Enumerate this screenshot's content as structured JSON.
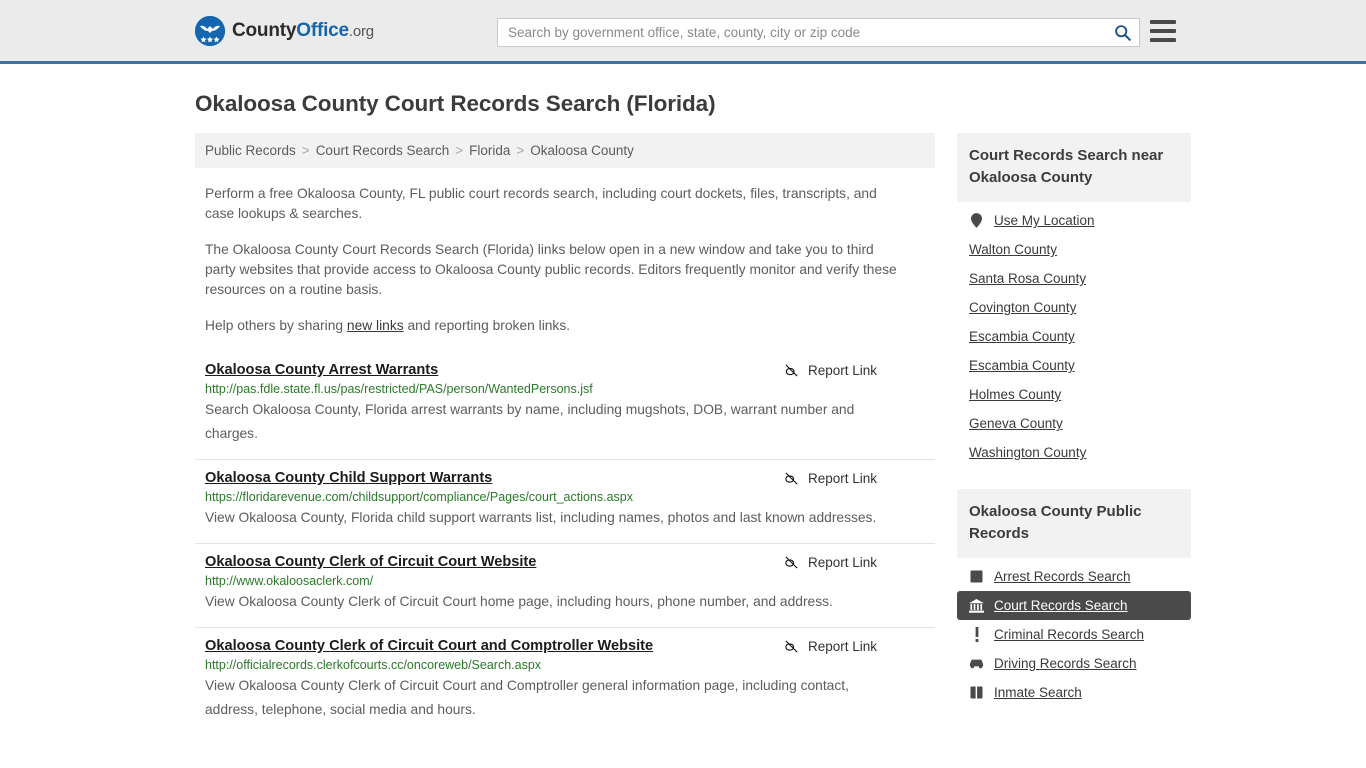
{
  "header": {
    "brand": {
      "part1": "County",
      "part2": "Office",
      "part3": ".org"
    },
    "search": {
      "placeholder": "Search by government office, state, county, city or zip code",
      "value": "",
      "icon": "search-icon"
    },
    "menu_icon": "hamburger-menu-icon"
  },
  "page": {
    "title": "Okaloosa County Court Records Search (Florida)"
  },
  "breadcrumb": {
    "items": [
      {
        "label": "Public Records"
      },
      {
        "label": "Court Records Search"
      },
      {
        "label": "Florida"
      },
      {
        "label": "Okaloosa County"
      }
    ],
    "separator": ">"
  },
  "intro": {
    "p1": "Perform a free Okaloosa County, FL public court records search, including court dockets, files, transcripts, and case lookups & searches.",
    "p2": "The Okaloosa County Court Records Search (Florida) links below open in a new window and take you to third party websites that provide access to Okaloosa County public records. Editors frequently monitor and verify these resources on a routine basis.",
    "p3_before": "Help others by sharing ",
    "p3_link": "new links",
    "p3_after": " and reporting broken links."
  },
  "report_link_label": "Report Link",
  "results": [
    {
      "title": "Okaloosa County Arrest Warrants",
      "url": "http://pas.fdle.state.fl.us/pas/restricted/PAS/person/WantedPersons.jsf",
      "description": "Search Okaloosa County, Florida arrest warrants by name, including mugshots, DOB, warrant number and charges."
    },
    {
      "title": "Okaloosa County Child Support Warrants",
      "url": "https://floridarevenue.com/childsupport/compliance/Pages/court_actions.aspx",
      "description": "View Okaloosa County, Florida child support warrants list, including names, photos and last known addresses."
    },
    {
      "title": "Okaloosa County Clerk of Circuit Court Website",
      "url": "http://www.okaloosaclerk.com/",
      "description": "View Okaloosa County Clerk of Circuit Court home page, including hours, phone number, and address."
    },
    {
      "title": "Okaloosa County Clerk of Circuit Court and Comptroller Website",
      "url": "http://officialrecords.clerkofcourts.cc/oncoreweb/Search.aspx",
      "description": "View Okaloosa County Clerk of Circuit Court and Comptroller general information page, including contact, address, telephone, social media and hours."
    }
  ],
  "sidebar": {
    "nearby": {
      "heading": "Court Records Search near Okaloosa County",
      "items": [
        {
          "label": "Use My Location",
          "icon": "map-pin-icon"
        },
        {
          "label": "Walton County",
          "icon": ""
        },
        {
          "label": "Santa Rosa County",
          "icon": ""
        },
        {
          "label": "Covington County",
          "icon": ""
        },
        {
          "label": "Escambia County",
          "icon": ""
        },
        {
          "label": "Escambia County",
          "icon": ""
        },
        {
          "label": "Holmes County",
          "icon": ""
        },
        {
          "label": "Geneva County",
          "icon": ""
        },
        {
          "label": "Washington County",
          "icon": ""
        }
      ]
    },
    "public_records": {
      "heading": "Okaloosa County Public Records",
      "items": [
        {
          "label": "Arrest Records Search",
          "icon": "fingerprint-icon",
          "active": false
        },
        {
          "label": "Court Records Search",
          "icon": "courthouse-icon",
          "active": true
        },
        {
          "label": "Criminal Records Search",
          "icon": "exclamation-icon",
          "active": false
        },
        {
          "label": "Driving Records Search",
          "icon": "car-icon",
          "active": false
        },
        {
          "label": "Inmate Search",
          "icon": "jail-icon",
          "active": false
        }
      ]
    }
  },
  "colors": {
    "header_bg": "#ebebeb",
    "header_border": "#3d72a4",
    "brand_blue": "#1566b0",
    "url_green": "#2a7a2a",
    "active_bg": "#4a4a4a"
  }
}
